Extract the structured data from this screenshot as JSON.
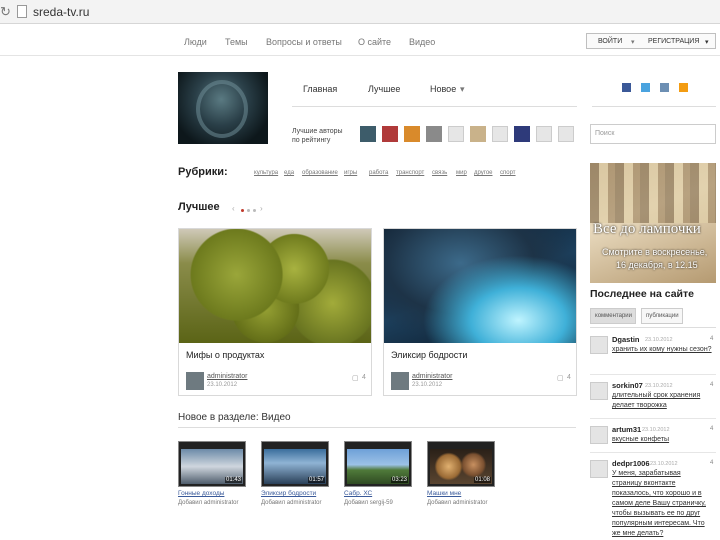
{
  "browser": {
    "url": "sreda-tv.ru"
  },
  "top_nav": {
    "items": [
      "Люди",
      "Темы",
      "Вопросы и ответы",
      "О сайте",
      "Видео"
    ],
    "login": "ВОЙТИ",
    "register": "РЕГИСТРАЦИЯ"
  },
  "main_nav": {
    "items": [
      "Главная",
      "Лучшее",
      "Новое"
    ]
  },
  "best_authors_label": "Лучшие авторы по рейтингу",
  "search": {
    "placeholder": "Поиск"
  },
  "rubrics": {
    "label": "Рубрики:",
    "tags": [
      "культура",
      "еда",
      "образование",
      "игры",
      "работа",
      "транспорт",
      "связь",
      "мир",
      "другое",
      "спорт"
    ]
  },
  "best": {
    "title": "Лучшее",
    "cards": [
      {
        "title": "Мифы о продуктах",
        "author": "administrator",
        "date": "23.10.2012",
        "comments": "4"
      },
      {
        "title": "Эликсир бодрости",
        "author": "administrator",
        "date": "23.10.2012",
        "comments": "4"
      }
    ]
  },
  "videos": {
    "title": "Новое в разделе: Видео",
    "items": [
      {
        "title": "Гонные доходы",
        "sub": "Добавил administrator",
        "duration": "01:43"
      },
      {
        "title": "Эликсир бодрости",
        "sub": "Добавил administrator",
        "duration": "01:57"
      },
      {
        "title": "Сабр. ХС",
        "sub": "Добавил sergij-59",
        "duration": "03:23"
      },
      {
        "title": "Машки мне",
        "sub": "Добавил administrator",
        "duration": "01:08"
      }
    ]
  },
  "ad": {
    "title": "Все до лампочки",
    "line1": "Смотрите в воскресенье,",
    "line2": "16 декабря, в 12.15"
  },
  "latest": {
    "title": "Последнее на сайте",
    "tabs": [
      "комментарии",
      "публикации"
    ],
    "comments": [
      {
        "user": "Dgastin",
        "date": "23.10.2012",
        "num": "4",
        "text": "хранить их кому нужны сезон?"
      },
      {
        "user": "sorkin07",
        "date": "23.10.2012",
        "num": "4",
        "text": "длительный срок хранения делает творожка"
      },
      {
        "user": "artum31",
        "date": "23.10.2012",
        "num": "4",
        "text": "вкусные конфеты"
      },
      {
        "user": "dedpr1006",
        "date": "23.10.2012",
        "num": "4",
        "text": "У меня, зарабатывая страницу вконтакте показалось, что хорошо и в самом деле Вашу страничку, чтобы вызывать ее по друг популярным интересам. Что же мне делать?"
      }
    ]
  },
  "colors": {
    "link": "#3a5a9a",
    "accent_dot": "#c0392b"
  }
}
